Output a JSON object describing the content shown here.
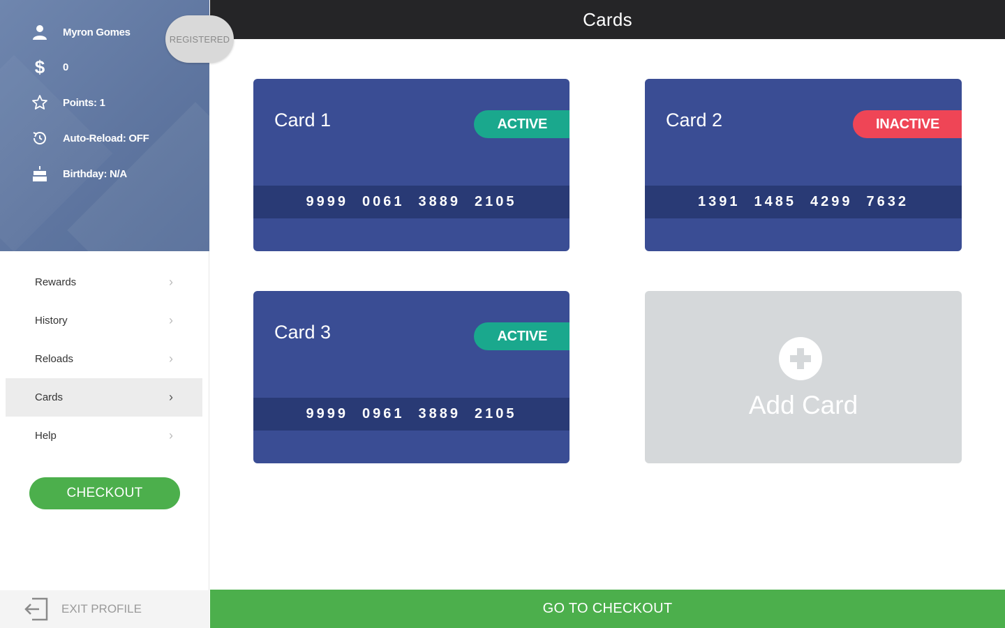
{
  "app": {
    "title": "Cards"
  },
  "profile": {
    "name": "Myron Gomes",
    "balance": "0",
    "points": "Points: 1",
    "auto_reload": "Auto-Reload: OFF",
    "birthday": "Birthday: N/A",
    "status_badge": "REGISTERED"
  },
  "nav": {
    "items": [
      {
        "label": "Rewards",
        "active": false
      },
      {
        "label": "History",
        "active": false
      },
      {
        "label": "Reloads",
        "active": false
      },
      {
        "label": "Cards",
        "active": true
      },
      {
        "label": "Help",
        "active": false
      }
    ],
    "chevron": "›"
  },
  "sidebar": {
    "checkout_label": "CHECKOUT",
    "exit_label": "EXIT PROFILE"
  },
  "cards": [
    {
      "name": "Card 1",
      "status": "ACTIVE",
      "status_color": "#1aa88d",
      "number": [
        "9999",
        "0061",
        "3889",
        "2105"
      ]
    },
    {
      "name": "Card 2",
      "status": "INACTIVE",
      "status_color": "#ef4556",
      "number": [
        "1391",
        "1485",
        "4299",
        "7632"
      ]
    },
    {
      "name": "Card 3",
      "status": "ACTIVE",
      "status_color": "#1aa88d",
      "number": [
        "9999",
        "0961",
        "3889",
        "2105"
      ]
    }
  ],
  "add_card": {
    "label": "Add Card"
  },
  "footer": {
    "checkout_label": "GO TO CHECKOUT"
  },
  "colors": {
    "card_bg": "#3a4d94",
    "card_number_bar": "#293a75",
    "green": "#4caf4c",
    "topbar": "#252527"
  }
}
